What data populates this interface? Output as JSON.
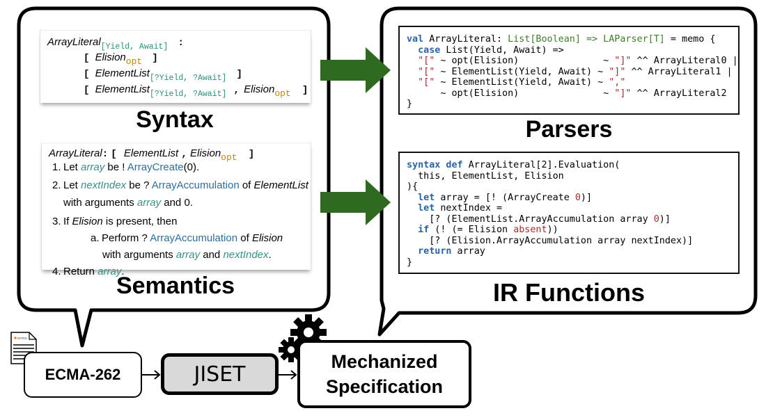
{
  "syntax_panel": {
    "heading": "Syntax",
    "production": {
      "lhs": "ArrayLiteral",
      "lhs_params": "[Yield, Await]",
      "colon": ":",
      "alternatives": [
        {
          "open": "[",
          "items": [
            {
              "nt": "Elision",
              "sub": "opt",
              "sub_kind": "opt"
            }
          ],
          "close": "]"
        },
        {
          "open": "[",
          "items": [
            {
              "nt": "ElementList",
              "sub": "[?Yield, ?Await]",
              "sub_kind": "param"
            }
          ],
          "close": "]"
        },
        {
          "open": "[",
          "items": [
            {
              "nt": "ElementList",
              "sub": "[?Yield, ?Await]",
              "sub_kind": "param"
            },
            {
              "sep": ","
            },
            {
              "nt": "Elision",
              "sub": "opt",
              "sub_kind": "opt"
            }
          ],
          "close": "]"
        }
      ]
    }
  },
  "semantics_panel": {
    "heading": "Semantics",
    "header": {
      "lhs": "ArrayLiteral",
      "colon": ":",
      "open": "[",
      "nt1": "ElementList",
      "sep": ",",
      "nt2": "Elision",
      "sub": "opt",
      "close": "]"
    },
    "steps": [
      {
        "num": "1.",
        "parts": [
          [
            "t",
            "Let "
          ],
          [
            "v",
            "array"
          ],
          [
            "t",
            " be ! "
          ],
          [
            "f",
            "ArrayCreate"
          ],
          [
            "t",
            "(0)."
          ]
        ]
      },
      {
        "num": "2.",
        "parts": [
          [
            "t",
            "Let "
          ],
          [
            "v",
            "nextIndex"
          ],
          [
            "t",
            " be ? "
          ],
          [
            "f",
            "ArrayAccumulation"
          ],
          [
            "t",
            " of "
          ],
          [
            "i",
            "ElementList"
          ]
        ]
      },
      {
        "num": "",
        "parts": [
          [
            "t",
            "with arguments "
          ],
          [
            "v",
            "array"
          ],
          [
            "t",
            " and 0."
          ]
        ]
      },
      {
        "num": "3.",
        "parts": [
          [
            "t",
            "If "
          ],
          [
            "i",
            "Elision"
          ],
          [
            "t",
            " is present, then"
          ]
        ]
      },
      {
        "num": "a.",
        "parts": [
          [
            "t",
            "Perform ? "
          ],
          [
            "f",
            "ArrayAccumulation"
          ],
          [
            "t",
            " of "
          ],
          [
            "i",
            "Elision"
          ]
        ]
      },
      {
        "num": "",
        "parts": [
          [
            "t",
            "with arguments "
          ],
          [
            "v",
            "array"
          ],
          [
            "t",
            " and "
          ],
          [
            "v",
            "nextIndex"
          ],
          [
            "t",
            "."
          ]
        ]
      },
      {
        "num": "4.",
        "parts": [
          [
            "t",
            "Return "
          ],
          [
            "v",
            "array"
          ],
          [
            "t",
            "."
          ]
        ]
      }
    ]
  },
  "parsers_panel": {
    "heading": "Parsers",
    "code_lines": [
      [
        [
          "kw",
          "val"
        ],
        [
          "p",
          " ArrayLiteral: "
        ],
        [
          "ty",
          "List[Boolean] => LAParser[T]"
        ],
        [
          "p",
          " = memo {"
        ]
      ],
      [
        [
          "p",
          "  "
        ],
        [
          "kw",
          "case"
        ],
        [
          "p",
          " List(Yield, Await) =>"
        ]
      ],
      [
        [
          "p",
          "  "
        ],
        [
          "str",
          "\"[\""
        ],
        [
          "p",
          " ~ opt(Elision)               ~ "
        ],
        [
          "str",
          "\"]\""
        ],
        [
          "p",
          " ^^ ArrayLiteral0 |"
        ]
      ],
      [
        [
          "p",
          "  "
        ],
        [
          "str",
          "\"[\""
        ],
        [
          "p",
          " ~ ElementList(Yield, Await) ~ "
        ],
        [
          "str",
          "\"]\""
        ],
        [
          "p",
          " ^^ ArrayLiteral1 |"
        ]
      ],
      [
        [
          "p",
          "  "
        ],
        [
          "str",
          "\"[\""
        ],
        [
          "p",
          " ~ ElementList(Yield, Await) ~ "
        ],
        [
          "str",
          "\",\""
        ]
      ],
      [
        [
          "p",
          "      ~ opt(Elision)               ~ "
        ],
        [
          "str",
          "\"]\""
        ],
        [
          "p",
          " ^^ ArrayLiteral2"
        ]
      ],
      [
        [
          "p",
          "}"
        ]
      ]
    ]
  },
  "ir_panel": {
    "heading": "IR Functions",
    "code_lines": [
      [
        [
          "kw",
          "syntax def"
        ],
        [
          "p",
          " ArrayLiteral[2].Evaluation("
        ]
      ],
      [
        [
          "p",
          "  this, ElementList, Elision"
        ]
      ],
      [
        [
          "p",
          "){"
        ]
      ],
      [
        [
          "p",
          "  "
        ],
        [
          "kw",
          "let"
        ],
        [
          "p",
          " array = [! (ArrayCreate "
        ],
        [
          "num",
          "0"
        ],
        [
          "p",
          ")]"
        ]
      ],
      [
        [
          "p",
          "  "
        ],
        [
          "kw",
          "let"
        ],
        [
          "p",
          " nextIndex ="
        ]
      ],
      [
        [
          "p",
          "    [? (ElementList.ArrayAccumulation array "
        ],
        [
          "num",
          "0"
        ],
        [
          "p",
          ")]"
        ]
      ],
      [
        [
          "p",
          "  "
        ],
        [
          "kw",
          "if"
        ],
        [
          "p",
          " (! (= Elision "
        ],
        [
          "num",
          "absent"
        ],
        [
          "p",
          "))"
        ]
      ],
      [
        [
          "p",
          "    [? (Elision.ArrayAccumulation array nextIndex)]"
        ]
      ],
      [
        [
          "p",
          "  "
        ],
        [
          "kw",
          "return"
        ],
        [
          "p",
          " array"
        ]
      ],
      [
        [
          "p",
          "}"
        ]
      ]
    ]
  },
  "pipeline": {
    "doc_icon_label": "ecma",
    "source": "ECMA-262",
    "tool": "JISET",
    "output_line1": "Mechanized",
    "output_line2": "Specification"
  },
  "colors": {
    "arrow_green": "#2e6b1f",
    "param_teal": "#2f8c7e",
    "opt_gold": "#b8860b",
    "keyword_blue": "#2b63a8",
    "type_green": "#3f7d2e",
    "string_red": "#a52a2a",
    "jiset_fill": "#d9d9d9",
    "ecma_orange": "#e8862a"
  }
}
